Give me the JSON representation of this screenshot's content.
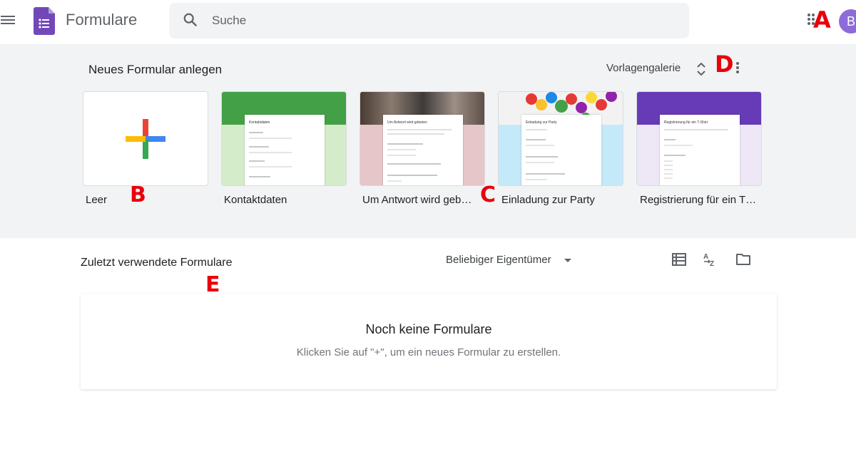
{
  "header": {
    "app_title": "Formulare",
    "search_placeholder": "Suche",
    "avatar_initial": "B",
    "icons": [
      "menu-icon",
      "forms-logo-icon",
      "search-icon",
      "apps-grid-icon"
    ]
  },
  "markers": {
    "a": "A",
    "b": "B",
    "c": "C",
    "d": "D",
    "e": "E"
  },
  "gallery": {
    "heading": "Neues Formular anlegen",
    "gallery_link": "Vorlagengalerie",
    "templates": [
      {
        "label": "Leer",
        "accent": "#ffffff"
      },
      {
        "label": "Kontaktdaten",
        "accent": "#43a047",
        "form_title": "Kontaktdaten"
      },
      {
        "label": "Um Antwort wird geb…",
        "accent": "#e6c6c9",
        "form_title": "Um Antwort wird gebeten"
      },
      {
        "label": "Einladung zur Party",
        "accent": "#c4e9f9",
        "form_title": "Einladung zur Party"
      },
      {
        "label": "Registrierung für ein T…",
        "accent": "#673ab7",
        "form_title": "Registrierung für ein T-Shirt"
      }
    ]
  },
  "recent": {
    "heading": "Zuletzt verwendete Formulare",
    "owner_filter": "Beliebiger Eigentümer",
    "empty_title": "Noch keine Formulare",
    "empty_subtitle": "Klicken Sie auf \"+\", um ein neues Formular zu erstellen."
  },
  "colors": {
    "brand_purple": "#673ab7",
    "plus_red": "#ea4335",
    "plus_blue": "#4285f4",
    "plus_green": "#34a853",
    "plus_yellow": "#fbbc04",
    "marker_red": "#e8000b"
  }
}
